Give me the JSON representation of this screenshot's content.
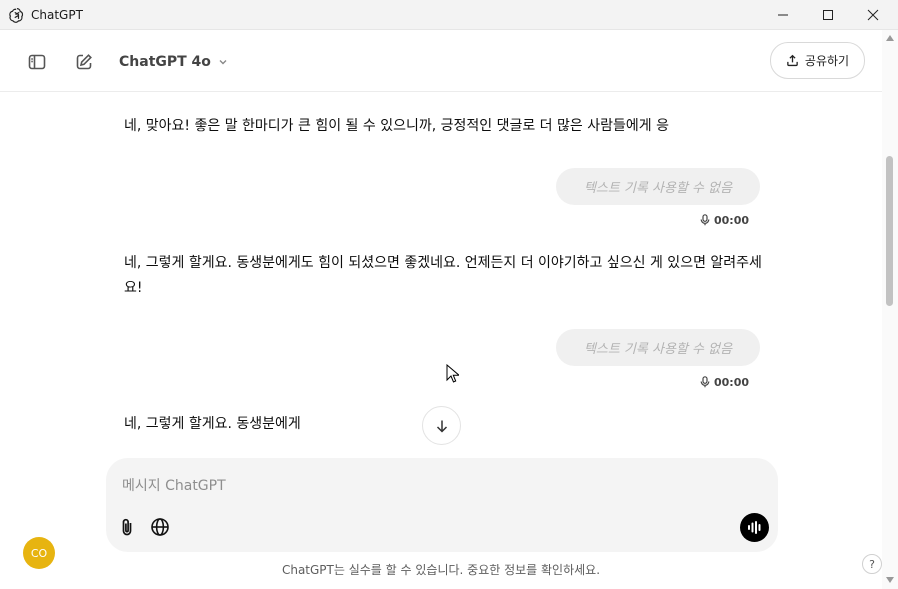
{
  "window": {
    "title": "ChatGPT",
    "app_icon": "openai-logo-icon",
    "controls": [
      "minimize-icon",
      "maximize-icon",
      "close-icon"
    ]
  },
  "header": {
    "sidebar_toggle_icon": "sidebar-toggle-icon",
    "new_chat_icon": "new-chat-icon",
    "model_label": "ChatGPT 4o",
    "model_chevron_icon": "chevron-down-icon",
    "share_label": "공유하기",
    "share_icon": "share-upload-icon"
  },
  "conversation": {
    "assistant_1": "네, 맞아요! 좋은 말 한마디가 큰 힘이 될 수 있으니까, 긍정적인 댓글로 더 많은 사람들에게 응",
    "user_1": "텍스트 기록 사용할 수 없음",
    "voice_1_duration": "00:00",
    "assistant_2": "네, 그렇게 할게요. 동생분에게도 힘이 되셨으면 좋겠네요. 언제든지 더 이야기하고 싶으신 게 있으면 알려주세요!",
    "user_2": "텍스트 기록 사용할 수 없음",
    "voice_2_duration": "00:00",
    "assistant_3": "네, 그렇게 할게요. 동생분에게",
    "scroll_down_icon": "arrow-down-icon",
    "mic_icon": "microphone-icon"
  },
  "composer": {
    "placeholder": "메시지 ChatGPT",
    "attach_icon": "paperclip-icon",
    "search_icon": "globe-icon",
    "voice_icon": "voice-waveform-icon"
  },
  "footer": {
    "avatar_initials": "CO",
    "avatar_color": "#e7b410",
    "disclaimer": "ChatGPT는 실수를 할 수 있습니다. 중요한 정보를 확인하세요.",
    "help_label": "?"
  }
}
